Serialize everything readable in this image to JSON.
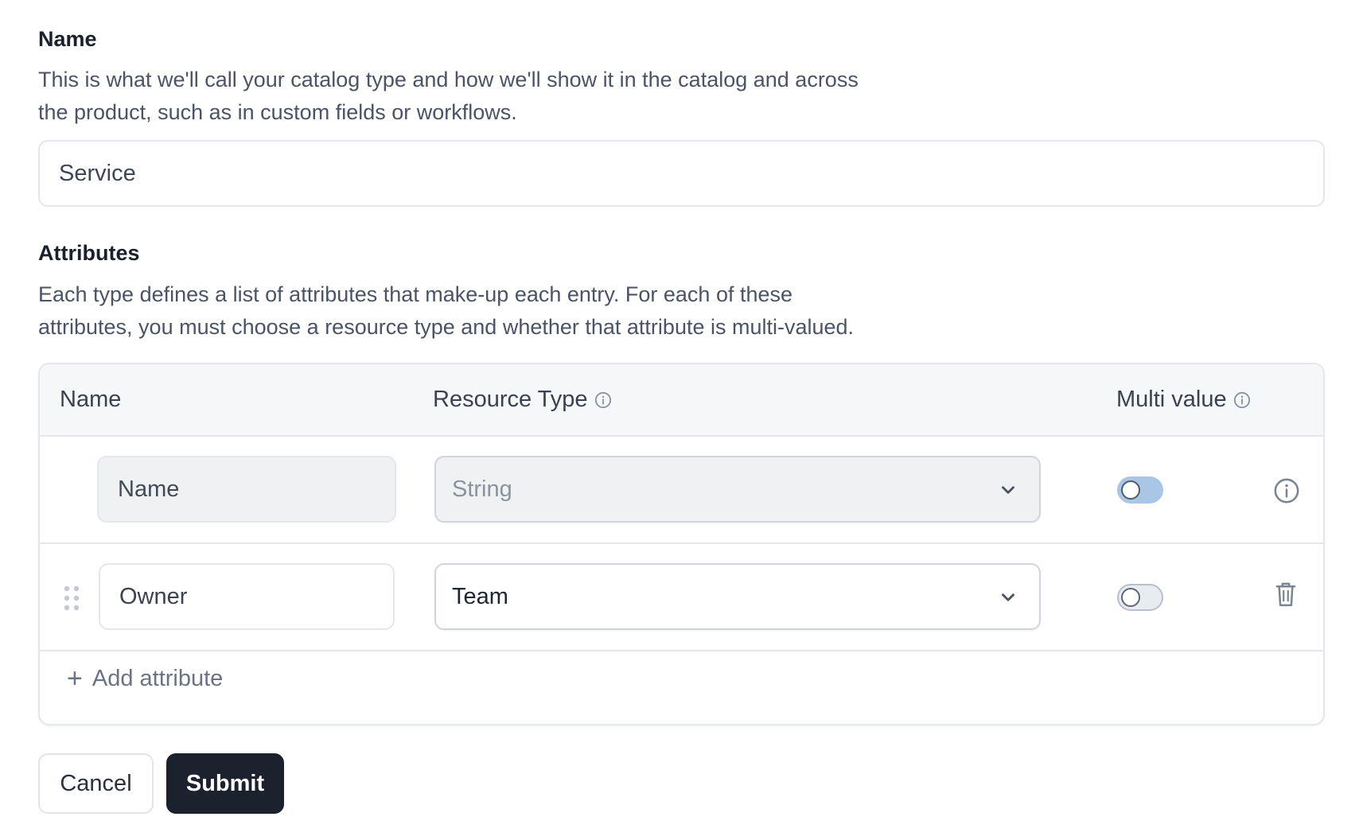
{
  "name_section": {
    "title": "Name",
    "description_line1": "This is what we'll call your catalog type and how we'll show it in the catalog and across",
    "description_line2": "the product, such as in custom fields or workflows.",
    "input_value": "Service"
  },
  "attributes_section": {
    "title": "Attributes",
    "description_line1": "Each type defines a list of attributes that make-up each entry. For each of these",
    "description_line2": "attributes, you must choose a resource type and whether that attribute is multi-valued.",
    "table": {
      "headers": {
        "name": "Name",
        "resource_type": "Resource Type",
        "multi_value": "Multi value"
      },
      "rows": [
        {
          "name": "Name",
          "resource_type": "String",
          "multi_value": false,
          "locked": true,
          "action_icon": "info-icon"
        },
        {
          "name": "Owner",
          "resource_type": "Team",
          "multi_value": false,
          "locked": false,
          "action_icon": "trash-icon"
        }
      ],
      "add_label": "Add attribute"
    }
  },
  "actions": {
    "cancel_label": "Cancel",
    "submit_label": "Submit"
  },
  "colors": {
    "primary_button": "#1b212d",
    "locked_toggle": "#a9c6e6",
    "header_bg": "#f6f7f9"
  }
}
